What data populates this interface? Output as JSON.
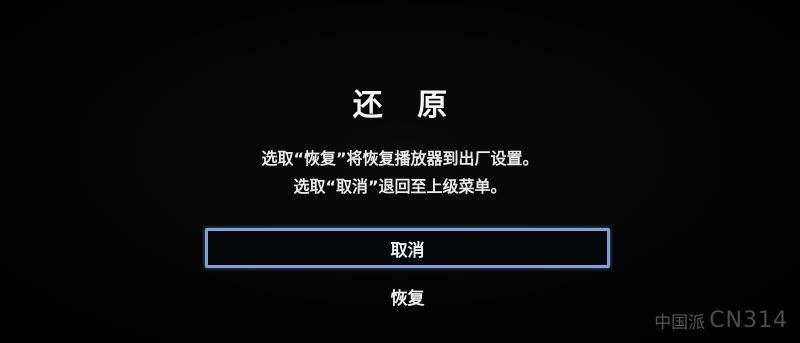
{
  "dialog": {
    "title": "还 原",
    "message_line1": "选取“恢复”将恢复播放器到出厂设置。",
    "message_line2": "选取“取消”退回至上级菜单。"
  },
  "options": [
    {
      "label": "取消",
      "selected": true
    },
    {
      "label": "恢复",
      "selected": false
    }
  ],
  "watermark": {
    "text": "中国派",
    "logo": "CN314"
  },
  "colors": {
    "background": "#020202",
    "text": "#f2f2f2",
    "selection_border": "#7f9fd8"
  }
}
